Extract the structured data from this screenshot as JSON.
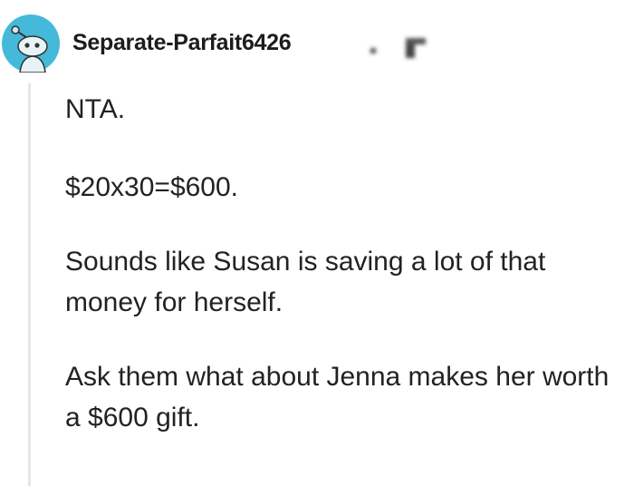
{
  "comment": {
    "author": "Separate-Parfait6426",
    "avatar_icon": "reddit-snoo-avatar-icon",
    "paragraphs": [
      "NTA.",
      "$20x30=$600.",
      "Sounds like Susan is saving a lot of that money for herself.",
      "Ask them what about Jenna makes her worth a $600 gift."
    ]
  },
  "colors": {
    "avatar_background": "#45b9d9",
    "thread_line": "#e4e6e8",
    "text": "#222222"
  }
}
